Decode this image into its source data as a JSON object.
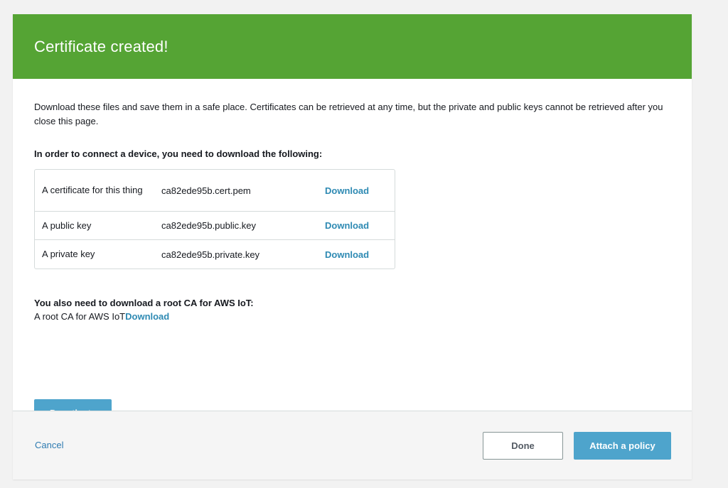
{
  "colors": {
    "header_bg": "#55a434",
    "link": "#2e8ab3",
    "primary_button": "#4ea4cc",
    "page_bg": "#f2f2f2"
  },
  "header": {
    "title": "Certificate created!"
  },
  "body": {
    "intro": "Download these files and save them in a safe place. Certificates can be retrieved at any time, but the private and public keys cannot be retrieved after you close this page.",
    "files_heading": "In order to connect a device, you need to download the following:",
    "files": [
      {
        "description": "A certificate for this thing",
        "filename": "ca82ede95b.cert.pem",
        "link": "Download"
      },
      {
        "description": "A public key",
        "filename": "ca82ede95b.public.key",
        "link": "Download"
      },
      {
        "description": "A private key",
        "filename": "ca82ede95b.private.key",
        "link": "Download"
      }
    ],
    "root_ca_heading": "You also need to download a root CA for AWS IoT:",
    "root_ca_label": "A root CA for AWS IoT",
    "root_ca_link": "Download",
    "deactivate_label": "Deactivate"
  },
  "footer": {
    "cancel_label": "Cancel",
    "done_label": "Done",
    "attach_label": "Attach a policy"
  }
}
